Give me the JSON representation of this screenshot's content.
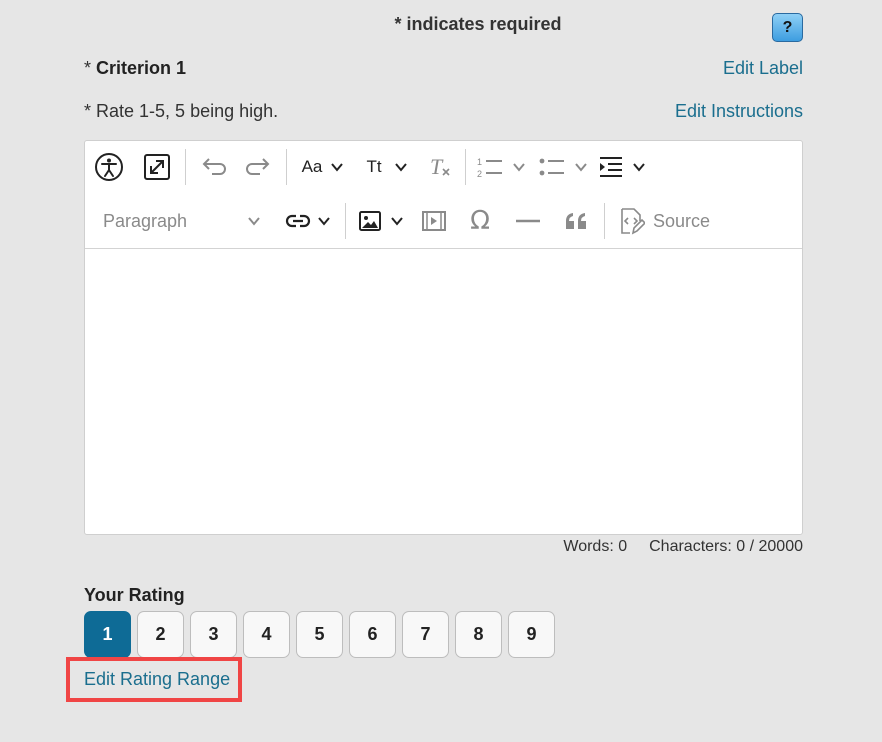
{
  "header": {
    "required_note": "* indicates required",
    "help_label": "?"
  },
  "criterion": {
    "required_star": "*",
    "name": "Criterion 1",
    "edit_label": "Edit Label",
    "instructions": "Rate 1-5, 5 being high.",
    "edit_instructions": "Edit Instructions"
  },
  "toolbar": {
    "font_size_label": "Aa",
    "text_style_label": "Tt",
    "paragraph_label": "Paragraph",
    "source_label": "Source"
  },
  "editor": {
    "content": ""
  },
  "counts": {
    "words": "Words: 0",
    "characters": "Characters: 0 / 20000"
  },
  "rating": {
    "label": "Your Rating",
    "options": [
      "1",
      "2",
      "3",
      "4",
      "5",
      "6",
      "7",
      "8",
      "9"
    ],
    "selected": "1",
    "edit_range": "Edit Rating Range"
  },
  "colors": {
    "link": "#1a6e8e",
    "selected_rating": "#0e6b96",
    "highlight_box": "#f04545",
    "background": "#e6e6e6"
  }
}
